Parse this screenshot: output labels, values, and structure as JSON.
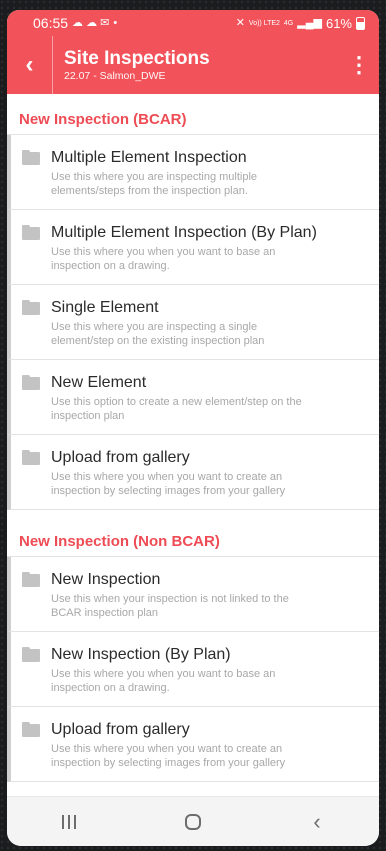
{
  "status_bar": {
    "time": "06:55",
    "notif_icons": "☁ ☁ ✉",
    "dot": "•",
    "mute_icon": "✕",
    "volte": "Vo)) LTE2",
    "net": "4G",
    "battery_pct": "61%"
  },
  "app_bar": {
    "back_icon": "‹",
    "title": "Site Inspections",
    "subtitle": "22.07 - Salmon_DWE",
    "menu_icon": "⋮"
  },
  "sections": [
    {
      "heading": "New Inspection (BCAR)",
      "items": [
        {
          "title": "Multiple Element Inspection",
          "desc": "Use this where you are inspecting multiple elements/steps from the inspection plan."
        },
        {
          "title": "Multiple Element Inspection (By Plan)",
          "desc": "Use this where you when you want to base an inspection on a drawing."
        },
        {
          "title": "Single Element",
          "desc": "Use this where you are inspecting a single element/step on the existing inspection plan"
        },
        {
          "title": "New Element",
          "desc": "Use this option to create a new element/step on the inspection plan"
        },
        {
          "title": "Upload from gallery",
          "desc": "Use this where you when you want to create an inspection by selecting images from your gallery"
        }
      ]
    },
    {
      "heading": "New Inspection (Non BCAR)",
      "items": [
        {
          "title": "New Inspection",
          "desc": "Use this when your inspection is not linked to the BCAR inspection plan"
        },
        {
          "title": "New Inspection (By Plan)",
          "desc": "Use this where you when you want to base an inspection on a drawing."
        },
        {
          "title": "Upload from gallery",
          "desc": "Use this where you when you want to create an inspection by selecting images from your gallery"
        }
      ]
    }
  ],
  "nav_bar": {
    "back_icon": "‹"
  },
  "colors": {
    "accent": "#f2535b",
    "section_heading": "#ee4c55"
  }
}
